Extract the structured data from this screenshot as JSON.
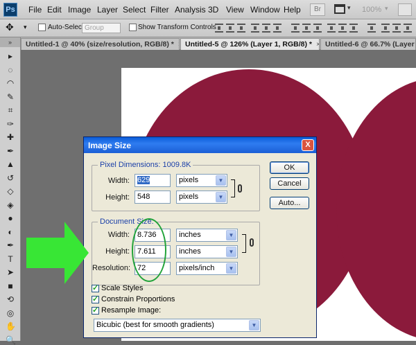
{
  "app": {
    "logo": "Ps"
  },
  "menu": [
    "File",
    "Edit",
    "Image",
    "Layer",
    "Select",
    "Filter",
    "Analysis",
    "3D",
    "View",
    "Window",
    "Help"
  ],
  "appbar": {
    "bridge_label": "Br",
    "zoom": "100%",
    "zoom_caret": "▾",
    "screen_caret": "▾"
  },
  "options": {
    "tool_caret": "▾",
    "auto_select_label": "Auto-Select:",
    "auto_select_value": "Group",
    "transform_label": "Show Transform Controls"
  },
  "tabs": [
    {
      "label": "Untitled-1 @ 40% (size/resolution, RGB/8) *",
      "close": "×"
    },
    {
      "label": "Untitled-5 @ 126% (Layer 1, RGB/8) *",
      "close": "×"
    },
    {
      "label": "Untitled-6 @ 66.7% (Layer 1",
      "close": ""
    }
  ],
  "toolbar": {
    "grip": "»"
  },
  "tools": [
    "move-tool",
    "marquee-tool",
    "lasso-tool",
    "quick-select-tool",
    "crop-tool",
    "eyedropper-tool",
    "spot-healing-tool",
    "brush-tool",
    "clone-stamp-tool",
    "history-brush-tool",
    "eraser-tool",
    "paint-bucket-tool",
    "blur-tool",
    "dodge-tool",
    "pen-tool",
    "type-tool",
    "path-select-tool",
    "shape-tool",
    "3d-rotate-tool",
    "3d-orbit-tool",
    "hand-tool",
    "zoom-tool"
  ],
  "tool_glyphs": [
    "▸",
    "◌",
    "◠",
    "✎",
    "⌗",
    "✑",
    "✚",
    "✒",
    "▲",
    "↺",
    "◇",
    "◈",
    "●",
    "◐",
    "✒",
    "T",
    "➤",
    "■",
    "⟲",
    "◎",
    "✋",
    "🔍"
  ],
  "dialog": {
    "title": "Image Size",
    "close": "X",
    "pixel_dimensions": {
      "legend": "Pixel Dimensions:",
      "size": "1009.8K",
      "width_label": "Width:",
      "width_value": "629",
      "width_unit": "pixels",
      "height_label": "Height:",
      "height_value": "548",
      "height_unit": "pixels"
    },
    "document_size": {
      "legend": "Document Size:",
      "width_label": "Width:",
      "width_value": "8.736",
      "width_unit": "inches",
      "height_label": "Height:",
      "height_value": "7.611",
      "height_unit": "inches",
      "resolution_label": "Resolution:",
      "resolution_value": "72",
      "resolution_unit": "pixels/inch"
    },
    "scale_styles": {
      "label": "Scale Styles",
      "checked": true
    },
    "constrain": {
      "label": "Constrain Proportions",
      "checked": true
    },
    "resample": {
      "label": "Resample Image:",
      "checked": true
    },
    "resample_method": "Bicubic (best for smooth gradients)",
    "buttons": {
      "ok": "OK",
      "cancel": "Cancel",
      "auto": "Auto..."
    }
  },
  "colors": {
    "heart": "#8b1a3b",
    "arrow": "#38e635",
    "ellipse": "#22a33a",
    "titlebar": "#1b5fd5"
  }
}
